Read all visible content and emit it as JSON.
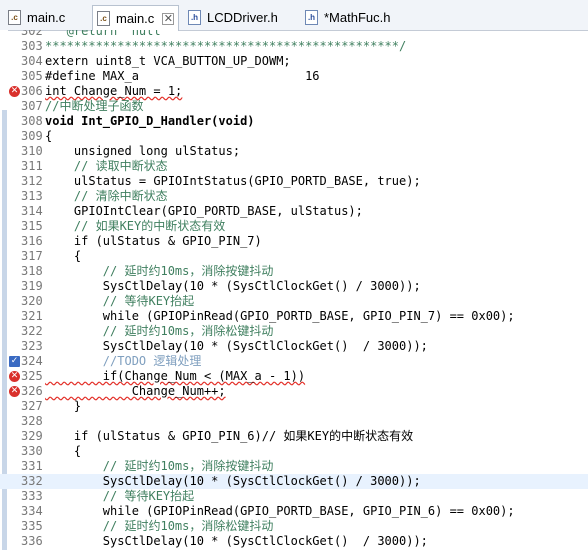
{
  "tabs": [
    {
      "label": "main.c",
      "icon": "c-file-icon",
      "active": false
    },
    {
      "label": "main.c",
      "icon": "c-file-icon",
      "active": true
    },
    {
      "label": "LCDDriver.h",
      "icon": "h-file-icon",
      "active": false
    },
    {
      "label": "*MathFuc.h",
      "icon": "h-file-icon",
      "active": false
    }
  ],
  "lines": [
    {
      "n": "302",
      "t": "   @return  null"
    },
    {
      "n": "303",
      "t": "*************************************************/"
    },
    {
      "n": "304",
      "t": "extern uint8_t VCA_BUTTON_UP_DOWM;"
    },
    {
      "n": "305",
      "t": "#define MAX_a                       16"
    },
    {
      "n": "306",
      "t": "int Change_Num = 1;"
    },
    {
      "n": "307",
      "t": "//中断处理子函数"
    },
    {
      "n": "308",
      "t": "void Int_GPIO_D_Handler(void)"
    },
    {
      "n": "309",
      "t": "{"
    },
    {
      "n": "310",
      "t": "    unsigned long ulStatus;"
    },
    {
      "n": "311",
      "t": "    // 读取中断状态"
    },
    {
      "n": "312",
      "t": "    ulStatus = GPIOIntStatus(GPIO_PORTD_BASE, true);"
    },
    {
      "n": "313",
      "t": "    // 清除中断状态"
    },
    {
      "n": "314",
      "t": "    GPIOIntClear(GPIO_PORTD_BASE, ulStatus);"
    },
    {
      "n": "315",
      "t": "    // 如果KEY的中断状态有效"
    },
    {
      "n": "316",
      "t": "    if (ulStatus & GPIO_PIN_7)"
    },
    {
      "n": "317",
      "t": "    {"
    },
    {
      "n": "318",
      "t": "        // 延时约10ms，消除按键抖动"
    },
    {
      "n": "319",
      "t": "        SysCtlDelay(10 * (SysCtlClockGet() / 3000));"
    },
    {
      "n": "320",
      "t": "        // 等待KEY抬起"
    },
    {
      "n": "321",
      "t": "        while (GPIOPinRead(GPIO_PORTD_BASE, GPIO_PIN_7) == 0x00);"
    },
    {
      "n": "322",
      "t": "        // 延时约10ms，消除松键抖动"
    },
    {
      "n": "323",
      "t": "        SysCtlDelay(10 * (SysCtlClockGet()  / 3000));"
    },
    {
      "n": "324",
      "t": "        //TODO 逻辑处理"
    },
    {
      "n": "325",
      "t": "        if(Change_Num < (MAX_a - 1))"
    },
    {
      "n": "326",
      "t": "            Change_Num++;"
    },
    {
      "n": "327",
      "t": "    }"
    },
    {
      "n": "328",
      "t": ""
    },
    {
      "n": "329",
      "t": "    if (ulStatus & GPIO_PIN_6)// 如果KEY的中断状态有效"
    },
    {
      "n": "330",
      "t": "    {"
    },
    {
      "n": "331",
      "t": "        // 延时约10ms，消除按键抖动"
    },
    {
      "n": "332",
      "t": "        SysCtlDelay(10 * (SysCtlClockGet() / 3000));"
    },
    {
      "n": "333",
      "t": "        // 等待KEY抬起"
    },
    {
      "n": "334",
      "t": "        while (GPIOPinRead(GPIO_PORTD_BASE, GPIO_PIN_6) == 0x00);"
    },
    {
      "n": "335",
      "t": "        // 延时约10ms，消除松键抖动"
    },
    {
      "n": "336",
      "t": "        SysCtlDelay(10 * (SysCtlClockGet()  / 3000));"
    }
  ]
}
